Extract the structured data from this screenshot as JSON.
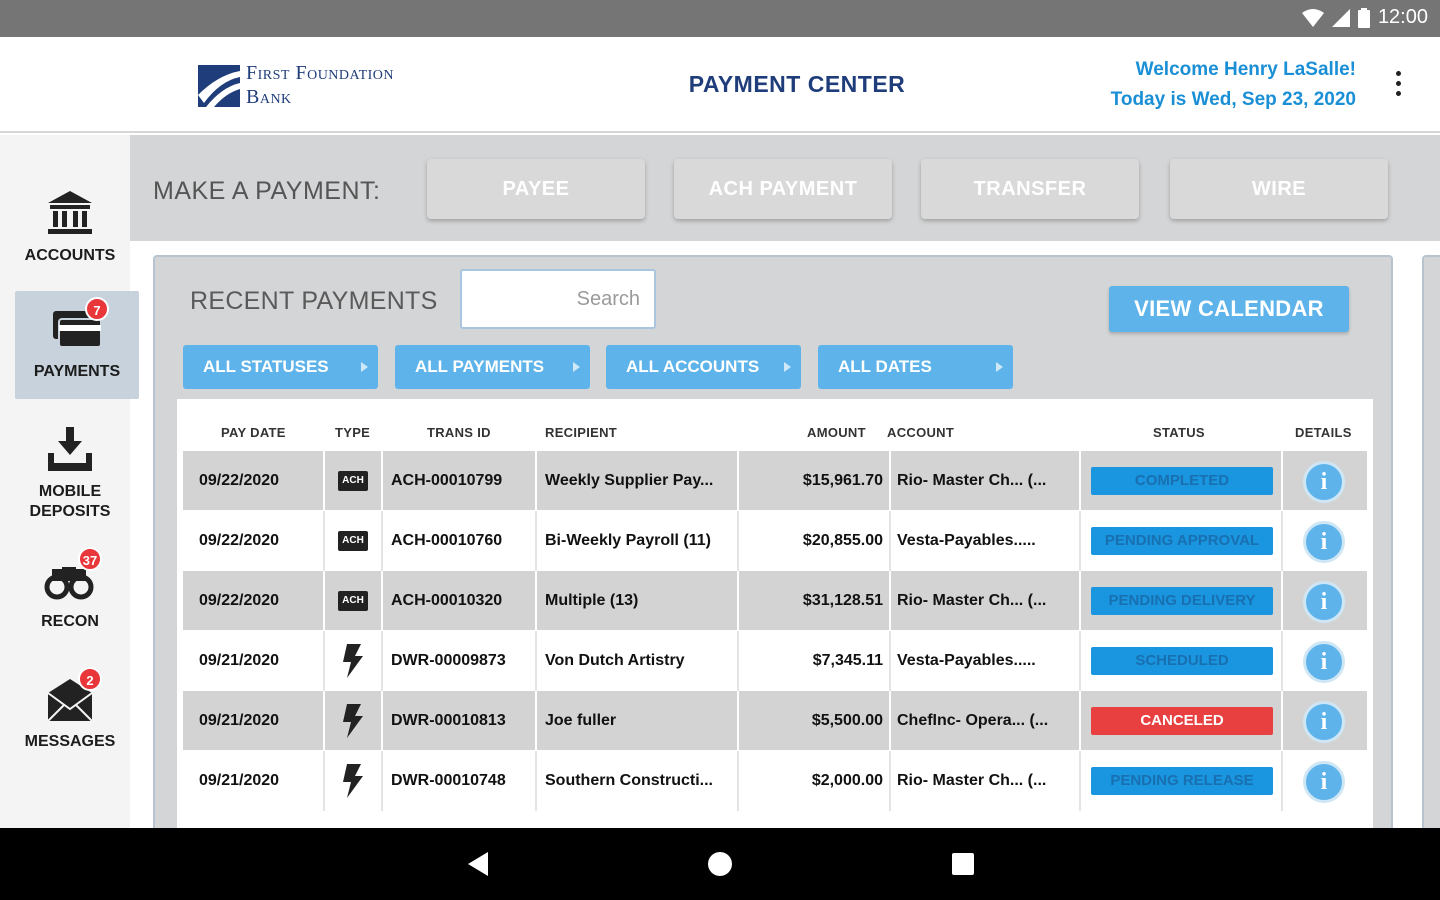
{
  "status_bar": {
    "time": "12:00"
  },
  "header": {
    "logo_line1": "First Foundation",
    "logo_line2": "Bank",
    "title": "PAYMENT CENTER",
    "welcome": "Welcome Henry LaSalle!",
    "date": "Today is Wed, Sep 23, 2020"
  },
  "sidebar": {
    "items": [
      {
        "label": "ACCOUNTS",
        "icon": "bank-icon"
      },
      {
        "label": "PAYMENTS",
        "icon": "credit-card-icon",
        "badge": "7",
        "active": true
      },
      {
        "label_line1": "MOBILE",
        "label_line2": "DEPOSITS",
        "icon": "download-tray-icon"
      },
      {
        "label": "RECON",
        "icon": "binoculars-icon",
        "badge": "37"
      },
      {
        "label": "MESSAGES",
        "icon": "envelope-icon",
        "badge": "2"
      }
    ]
  },
  "make_payment": {
    "label": "MAKE A PAYMENT:",
    "buttons": [
      "PAYEE",
      "ACH PAYMENT",
      "TRANSFER",
      "WIRE"
    ]
  },
  "recent": {
    "title": "RECENT PAYMENTS",
    "search_placeholder": "Search",
    "view_calendar": "VIEW CALENDAR",
    "filters": [
      "ALL STATUSES",
      "ALL PAYMENTS",
      "ALL ACCOUNTS",
      "ALL DATES"
    ],
    "columns": [
      "PAY DATE",
      "TYPE",
      "TRANS ID",
      "RECIPIENT",
      "AMOUNT",
      "ACCOUNT",
      "STATUS",
      "DETAILS"
    ],
    "rows": [
      {
        "date": "09/22/2020",
        "type": "ACH",
        "trans_id": "ACH-00010799",
        "recipient": "Weekly Supplier Pay...",
        "amount": "$15,961.70",
        "account": "Rio- Master Ch... (...",
        "status": "COMPLETED",
        "status_color": "blue"
      },
      {
        "date": "09/22/2020",
        "type": "ACH",
        "trans_id": "ACH-00010760",
        "recipient": "Bi-Weekly Payroll (11)",
        "amount": "$20,855.00",
        "account": "Vesta-Payables.....",
        "status": "PENDING APPROVAL",
        "status_color": "blue"
      },
      {
        "date": "09/22/2020",
        "type": "ACH",
        "trans_id": "ACH-00010320",
        "recipient": "Multiple (13)",
        "amount": "$31,128.51",
        "account": "Rio- Master Ch... (...",
        "status": "PENDING DELIVERY",
        "status_color": "blue"
      },
      {
        "date": "09/21/2020",
        "type": "WIRE",
        "trans_id": "DWR-00009873",
        "recipient": "Von Dutch Artistry",
        "amount": "$7,345.11",
        "account": "Vesta-Payables.....",
        "status": "SCHEDULED",
        "status_color": "blue"
      },
      {
        "date": "09/21/2020",
        "type": "WIRE",
        "trans_id": "DWR-00010813",
        "recipient": "Joe fuller",
        "amount": "$5,500.00",
        "account": "ChefInc- Opera... (...",
        "status": "CANCELED",
        "status_color": "red"
      },
      {
        "date": "09/21/2020",
        "type": "WIRE",
        "trans_id": "DWR-00010748",
        "recipient": "Southern Constructi...",
        "amount": "$2,000.00",
        "account": "Rio- Master Ch... (...",
        "status": "PENDING RELEASE",
        "status_color": "blue"
      }
    ]
  },
  "colors": {
    "accent": "#5eb4ea",
    "brand": "#1f3d7a",
    "status_blue": "#1a95e0",
    "status_red": "#e84040",
    "badge_red": "#e8363a"
  }
}
